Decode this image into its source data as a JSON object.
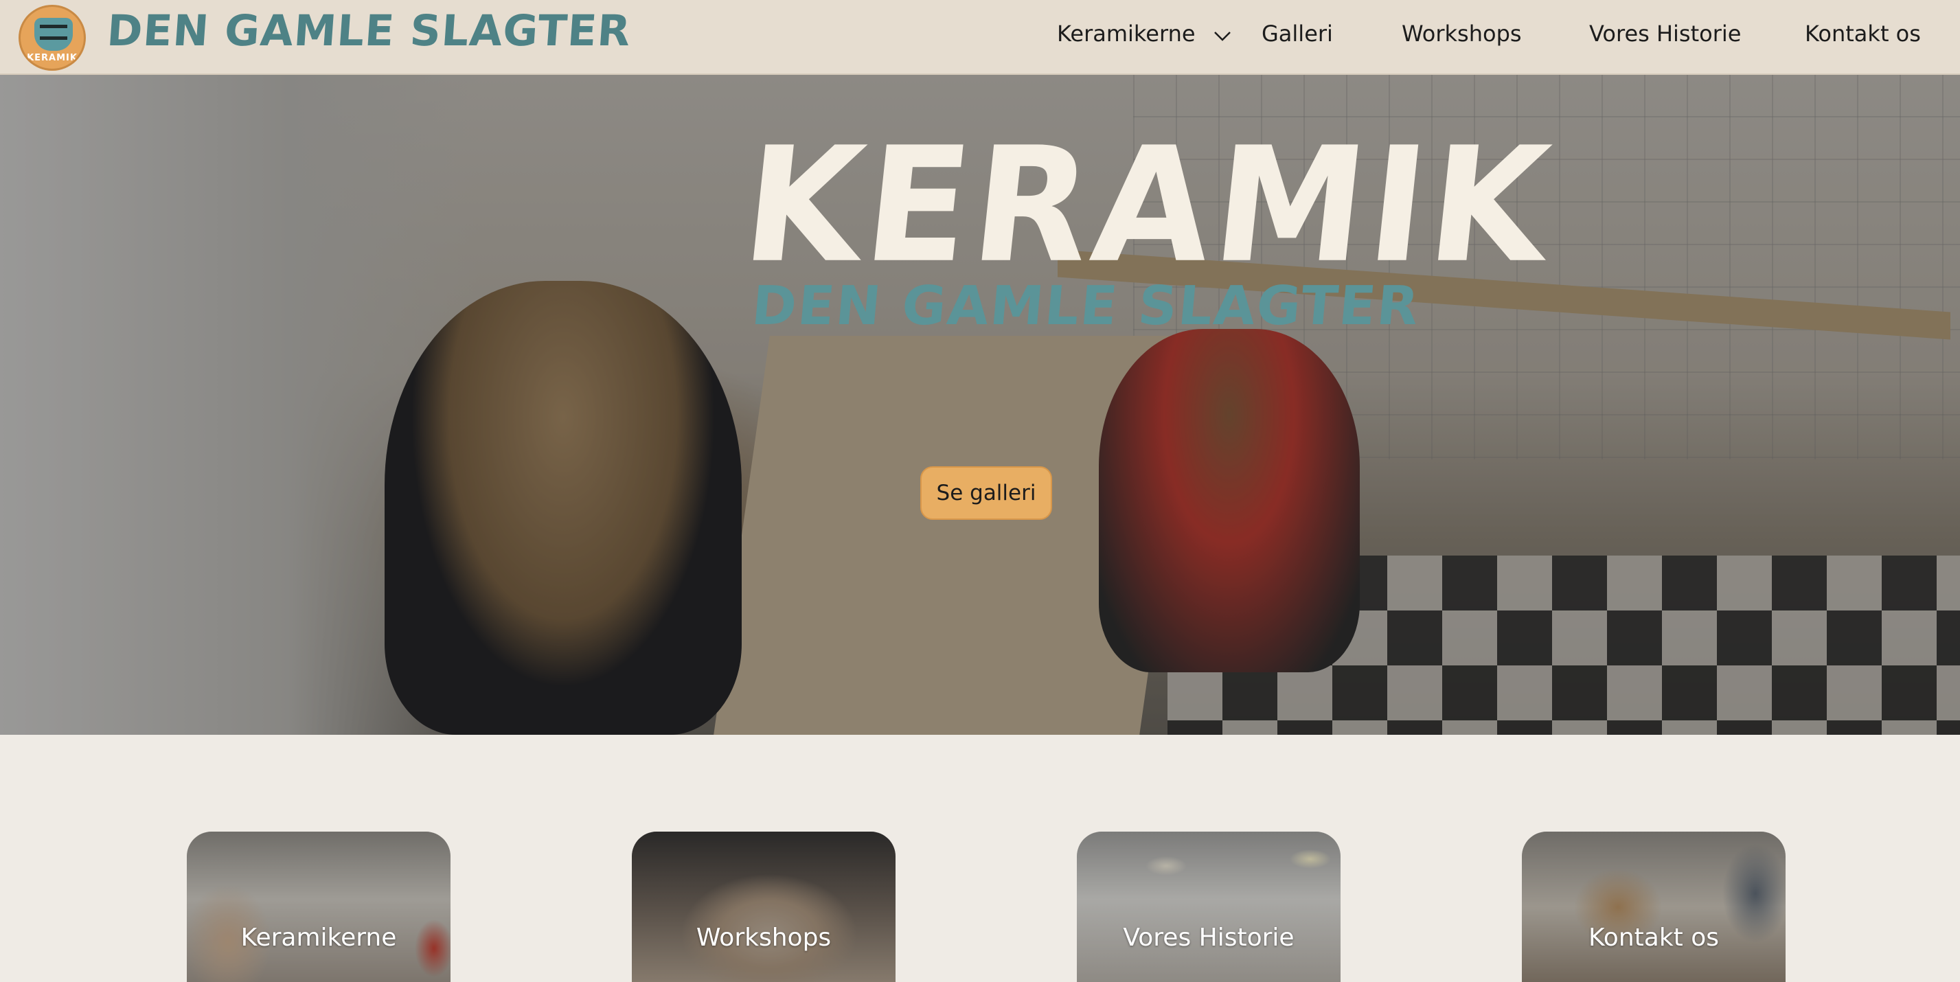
{
  "header": {
    "logo_badge_text": "KERAMIK",
    "brand": "DEN GAMLE SLAGTER",
    "nav": [
      {
        "label": "Keramikerne",
        "has_dropdown": true,
        "icon": "chevron-down-icon"
      },
      {
        "label": "Galleri"
      },
      {
        "label": "Workshops"
      },
      {
        "label": "Vores Historie"
      },
      {
        "label": "Kontakt os"
      }
    ]
  },
  "hero": {
    "title": "KERAMIK",
    "subtitle": "DEN GAMLE SLAGTER",
    "button": "Se galleri"
  },
  "cards": [
    {
      "label": "Keramikerne"
    },
    {
      "label": "Workshops"
    },
    {
      "label": "Vores Historie"
    },
    {
      "label": "Kontakt os"
    }
  ],
  "colors": {
    "header_bg": "#e6ddd0",
    "page_bg": "#efebe5",
    "brand_teal": "#4e8286",
    "button_orange": "#e8ae63",
    "title_cream": "#f5efe4"
  }
}
